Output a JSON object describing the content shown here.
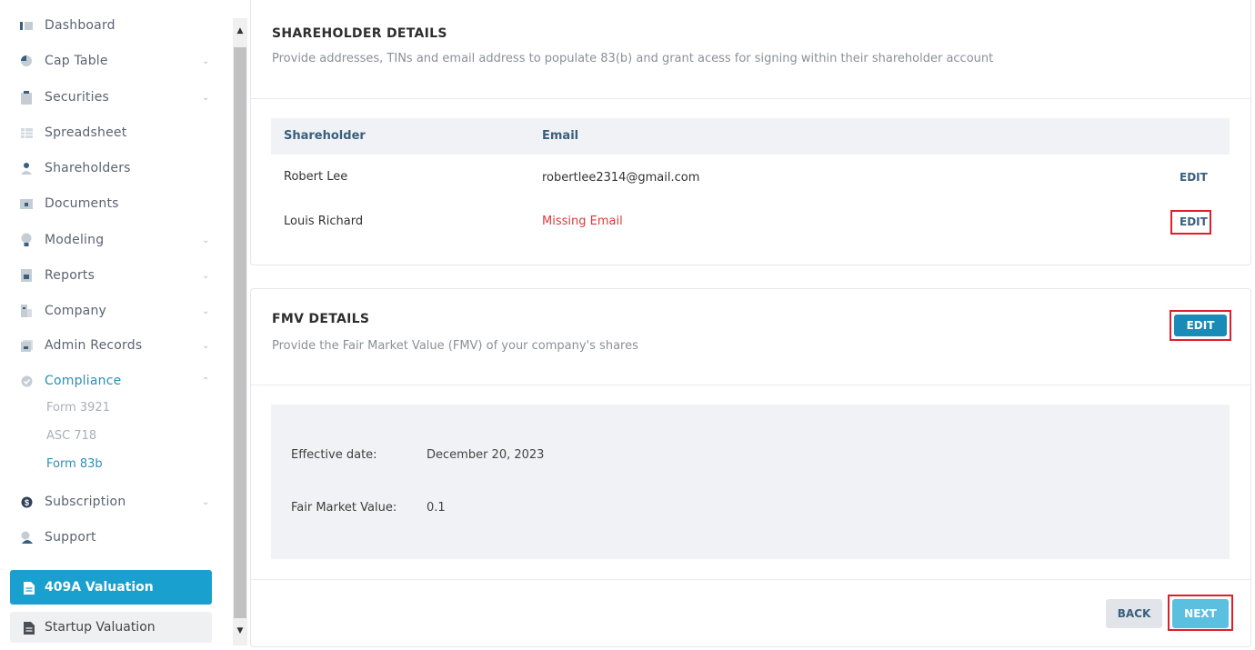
{
  "sidebar": {
    "items": [
      {
        "label": "Dashboard",
        "icon": "dashboard-icon"
      },
      {
        "label": "Cap Table",
        "icon": "pie-chart-icon",
        "chevron": "⌄"
      },
      {
        "label": "Securities",
        "icon": "clipboard-icon",
        "chevron": "⌄"
      },
      {
        "label": "Spreadsheet",
        "icon": "table-icon"
      },
      {
        "label": "Shareholders",
        "icon": "user-icon"
      },
      {
        "label": "Documents",
        "icon": "folder-icon"
      },
      {
        "label": "Modeling",
        "icon": "lightbulb-icon",
        "chevron": "⌄"
      },
      {
        "label": "Reports",
        "icon": "report-icon",
        "chevron": "⌄"
      },
      {
        "label": "Company",
        "icon": "building-icon",
        "chevron": "⌄"
      },
      {
        "label": "Admin Records",
        "icon": "records-icon",
        "chevron": "⌄"
      },
      {
        "label": "Compliance",
        "icon": "shield-check-icon",
        "chevron": "⌃"
      },
      {
        "label": "Subscription",
        "icon": "dollar-icon",
        "chevron": "⌄"
      },
      {
        "label": "Support",
        "icon": "support-icon"
      }
    ],
    "compliance_sub": [
      "Form 3921",
      "ASC 718",
      "Form 83b"
    ],
    "btn_409a": "409A Valuation",
    "btn_startup": "Startup Valuation"
  },
  "scrollbar": {
    "up": "▲",
    "down": "▼"
  },
  "shareholder": {
    "title": "SHAREHOLDER DETAILS",
    "subtitle": "Provide addresses, TINs and email address to populate 83(b) and grant acess for signing within their shareholder account",
    "columns": [
      "Shareholder",
      "Email"
    ],
    "rows": [
      {
        "name": "Robert Lee",
        "email": "robertlee2314@gmail.com",
        "action": "EDIT"
      },
      {
        "name": "Louis Richard",
        "email": "Missing Email",
        "action": "EDIT"
      }
    ]
  },
  "fmv": {
    "title": "FMV DETAILS",
    "subtitle": "Provide the Fair Market Value (FMV) of your company's shares",
    "edit": "EDIT",
    "effective_label": "Effective date:",
    "effective_value": "December 20, 2023",
    "fmv_label": "Fair Market Value:",
    "fmv_value": "0.1"
  },
  "footer": {
    "back": "BACK",
    "next": "NEXT"
  },
  "colors": {
    "accent": "#1aa0cf",
    "missing": "#d83b3b",
    "highlight": "#e01e2b"
  }
}
